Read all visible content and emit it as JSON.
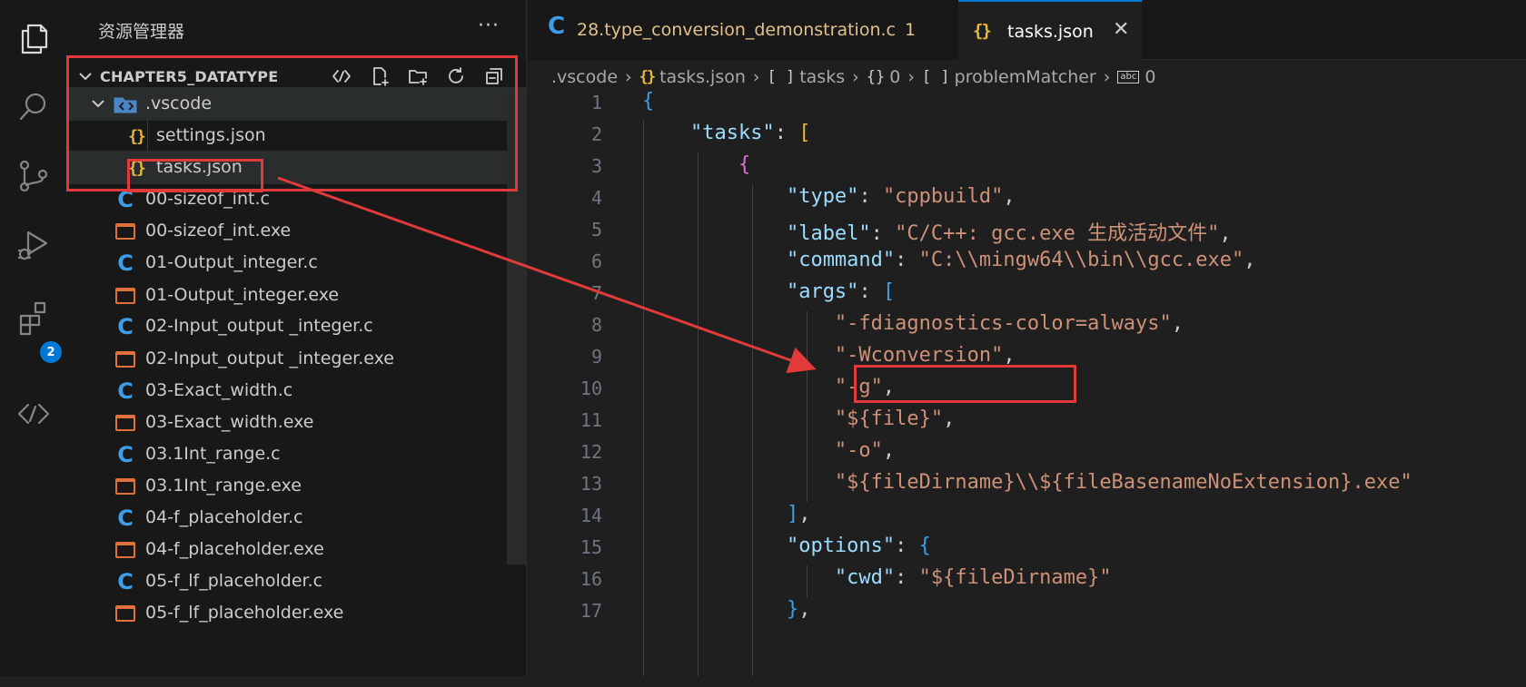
{
  "activity_bar": {
    "icons": [
      "explorer-icon",
      "search-icon",
      "source-control-icon",
      "run-debug-icon",
      "extensions-icon",
      "remote-icon"
    ],
    "extensions_badge": "2"
  },
  "sidebar": {
    "title": "资源管理器",
    "more": "···",
    "section_title": "CHAPTER5_DATATYPE",
    "items": [
      {
        "label": ".vscode",
        "type": "folder"
      },
      {
        "label": "settings.json",
        "type": "json"
      },
      {
        "label": "tasks.json",
        "type": "json"
      },
      {
        "label": "00-sizeof_int.c",
        "type": "c"
      },
      {
        "label": "00-sizeof_int.exe",
        "type": "exe"
      },
      {
        "label": "01-Output_integer.c",
        "type": "c"
      },
      {
        "label": "01-Output_integer.exe",
        "type": "exe"
      },
      {
        "label": "02-Input_output _integer.c",
        "type": "c"
      },
      {
        "label": "02-Input_output _integer.exe",
        "type": "exe"
      },
      {
        "label": "03-Exact_width.c",
        "type": "c"
      },
      {
        "label": "03-Exact_width.exe",
        "type": "exe"
      },
      {
        "label": "03.1Int_range.c",
        "type": "c"
      },
      {
        "label": "03.1Int_range.exe",
        "type": "exe"
      },
      {
        "label": "04-f_placeholder.c",
        "type": "c"
      },
      {
        "label": "04-f_placeholder.exe",
        "type": "exe"
      },
      {
        "label": "05-f_lf_placeholder.c",
        "type": "c"
      },
      {
        "label": "05-f_lf_placeholder.exe",
        "type": "exe"
      }
    ]
  },
  "tabs": [
    {
      "label": "28.type_conversion_demonstration.c",
      "badge": "1",
      "active": false
    },
    {
      "label": "tasks.json",
      "active": true
    }
  ],
  "breadcrumb": [
    ".vscode",
    "tasks.json",
    "tasks",
    "0",
    "problemMatcher",
    "0"
  ],
  "editor": {
    "line_numbers": [
      "1",
      "2",
      "3",
      "4",
      "5",
      "6",
      "7",
      "8",
      "9",
      "10",
      "11",
      "12",
      "13",
      "14",
      "15",
      "16",
      "17"
    ],
    "tokens": {
      "tasks_key": "\"tasks\"",
      "type_key": "\"type\"",
      "type_val": "\"cppbuild\"",
      "label_key": "\"label\"",
      "label_val": "\"C/C++: gcc.exe 生成活动文件\"",
      "command_key": "\"command\"",
      "command_val": "\"C:\\\\mingw64\\\\bin\\\\gcc.exe\"",
      "args_key": "\"args\"",
      "arg1": "\"-fdiagnostics-color=always\"",
      "arg2": "\"-Wconversion\"",
      "arg3": "\"-g\"",
      "arg4": "\"${file}\"",
      "arg5": "\"-o\"",
      "arg6": "\"${fileDirname}\\\\${fileBasenameNoExtension}.exe\"",
      "options_key": "\"options\"",
      "cwd_key": "\"cwd\"",
      "cwd_val": "\"${fileDirname}\""
    }
  },
  "colors": {
    "annotation": "#e03a3a",
    "accent": "#0078d4"
  }
}
